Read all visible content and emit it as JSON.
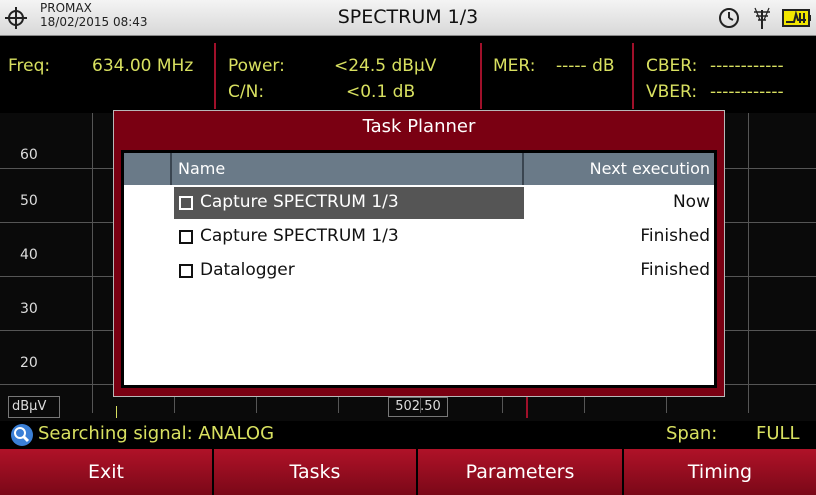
{
  "header": {
    "brand": "PROMAX",
    "datetime": "18/02/2015 08:43",
    "title": "SPECTRUM 1/3",
    "icons": [
      "crosshair-icon",
      "clock-icon",
      "antenna-icon",
      "battery-charging-icon"
    ]
  },
  "measurements": {
    "freq_label": "Freq:",
    "freq_value": "634.00 MHz",
    "power_label": "Power:",
    "power_value": "<24.5 dBµV",
    "cn_label": "C/N:",
    "cn_value": "<0.1 dB",
    "mer_label": "MER:",
    "mer_value": "----- dB",
    "cber_label": "CBER:",
    "cber_value": "------------",
    "vber_label": "VBER:",
    "vber_value": "------------"
  },
  "spectrum": {
    "y_ticks": [
      "60",
      "50",
      "40",
      "30",
      "20"
    ],
    "unit": "dBµV",
    "center_freq": "502.50"
  },
  "status": {
    "icon": "search-icon",
    "message": "Searching signal: ANALOG",
    "span_label": "Span:",
    "span_value": "FULL"
  },
  "dialog": {
    "title": "Task Planner",
    "columns": [
      "Name",
      "Next execution"
    ],
    "rows": [
      {
        "name": "Capture SPECTRUM 1/3",
        "next": "Now",
        "checked": false,
        "selected": true
      },
      {
        "name": "Capture SPECTRUM 1/3",
        "next": "Finished",
        "checked": false,
        "selected": false
      },
      {
        "name": "Datalogger",
        "next": "Finished",
        "checked": false,
        "selected": false
      }
    ]
  },
  "softkeys": [
    "Exit",
    "Tasks",
    "Parameters",
    "Timing"
  ],
  "colors": {
    "accent_red": "#a0102a",
    "measure_text": "#d8e060",
    "dialog_frame": "#7a0012"
  }
}
